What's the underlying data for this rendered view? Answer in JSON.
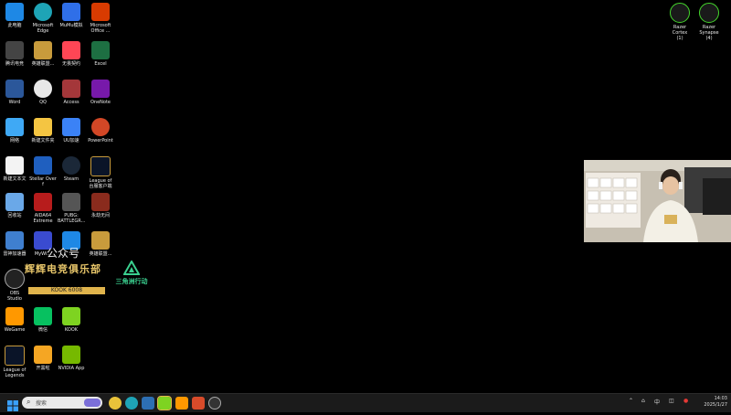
{
  "desktop_icons": [
    {
      "label": "此电脑",
      "color": "#1e88e5",
      "icon": "computer-icon"
    },
    {
      "label": "Microsoft\nEdge",
      "color": "#1ea4b6",
      "icon": "edge-icon"
    },
    {
      "label": "MuMu模拟",
      "color": "#2f6fe8",
      "icon": "mumu-icon"
    },
    {
      "label": "Microsoft\nOffice ...",
      "color": "#d83b01",
      "icon": "office-icon"
    },
    {
      "label": "腾讯电竞",
      "color": "#444",
      "icon": "app-icon"
    },
    {
      "label": "英雄联盟...",
      "color": "#c89b3c",
      "icon": "lol-icon"
    },
    {
      "label": "无畏契约",
      "color": "#ff4655",
      "icon": "valorant-icon"
    },
    {
      "label": "Excel",
      "color": "#1d6f42",
      "icon": "excel-icon"
    },
    {
      "label": "Word",
      "color": "#2b579a",
      "icon": "word-icon"
    },
    {
      "label": "QQ",
      "color": "#e8e8e8",
      "icon": "qq-icon"
    },
    {
      "label": "Access",
      "color": "#a4373a",
      "icon": "access-icon"
    },
    {
      "label": "OneNote",
      "color": "#7719aa",
      "icon": "onenote-icon"
    },
    {
      "label": "网络",
      "color": "#3fa9f5",
      "icon": "network-icon"
    },
    {
      "label": "新建文件夹",
      "color": "#f4c542",
      "icon": "folder-icon"
    },
    {
      "label": "UU加速",
      "color": "#3b82f6",
      "icon": "uu-icon"
    },
    {
      "label": "PowerPoint",
      "color": "#d24726",
      "icon": "powerpoint-icon"
    },
    {
      "label": "新建文本文",
      "color": "#f3f3f3",
      "icon": "text-file-icon"
    },
    {
      "label": "Stellar Over\nf",
      "color": "#1f5fbf",
      "icon": "app-icon"
    },
    {
      "label": "Steam",
      "color": "#1b2838",
      "icon": "steam-icon"
    },
    {
      "label": "League of\n台服客户端",
      "color": "#0a1428",
      "icon": "lol-icon"
    },
    {
      "label": "回收站",
      "color": "#6aa8e8",
      "icon": "recycle-bin-icon"
    },
    {
      "label": "AIDA64\nExtreme",
      "color": "#b71c1c",
      "icon": "aida64-icon"
    },
    {
      "label": "PUBG:\nBATTLEGR...",
      "color": "#555",
      "icon": "pubg-icon"
    },
    {
      "label": "永劫无间",
      "color": "#8a2b1d",
      "icon": "game-icon"
    },
    {
      "label": "雷神加速器",
      "color": "#3f7fcf",
      "icon": "app-icon"
    },
    {
      "label": "MyWi...",
      "color": "#3a4bd0",
      "icon": "app-icon"
    },
    {
      "label": "...",
      "color": "#1e88e5",
      "icon": "app-icon"
    },
    {
      "label": "英雄联盟...",
      "color": "#c89b3c",
      "icon": "lol-icon"
    },
    {
      "label": "OBS\nStudio",
      "color": "#222",
      "icon": "obs-icon"
    },
    {
      "label": "WeGame",
      "color": "#ff9800",
      "icon": "app-icon"
    },
    {
      "label": "微信",
      "color": "#07c160",
      "icon": "wechat-icon"
    },
    {
      "label": "KOOK",
      "color": "#7ed321",
      "icon": "kook-icon"
    },
    {
      "label": "League of\nLegends",
      "color": "#0a1428",
      "icon": "lol-icon"
    },
    {
      "label": "开黑啦",
      "color": "#f5a623",
      "icon": "app-icon"
    },
    {
      "label": "NVIDIA App",
      "color": "#76b900",
      "icon": "nvidia-icon"
    }
  ],
  "right_icons": [
    {
      "label": "Razer Cortex\n(1)",
      "icon": "razer-icon"
    },
    {
      "label": "Razer Synapse\n(4)",
      "icon": "razer-icon"
    }
  ],
  "overlay": {
    "public_account": "公众号",
    "club_name": "辉辉电竞俱乐部",
    "sub_line": "KOOK 6008",
    "brand_text": "三角洲行动"
  },
  "taskbar": {
    "search_placeholder": "搜索",
    "tray_ime": "中",
    "time": "14:03",
    "date": "2025/1/27"
  },
  "colors": {
    "desktop": "#000000",
    "taskbar": "#1b1b1b",
    "accent": "#0078d4"
  }
}
